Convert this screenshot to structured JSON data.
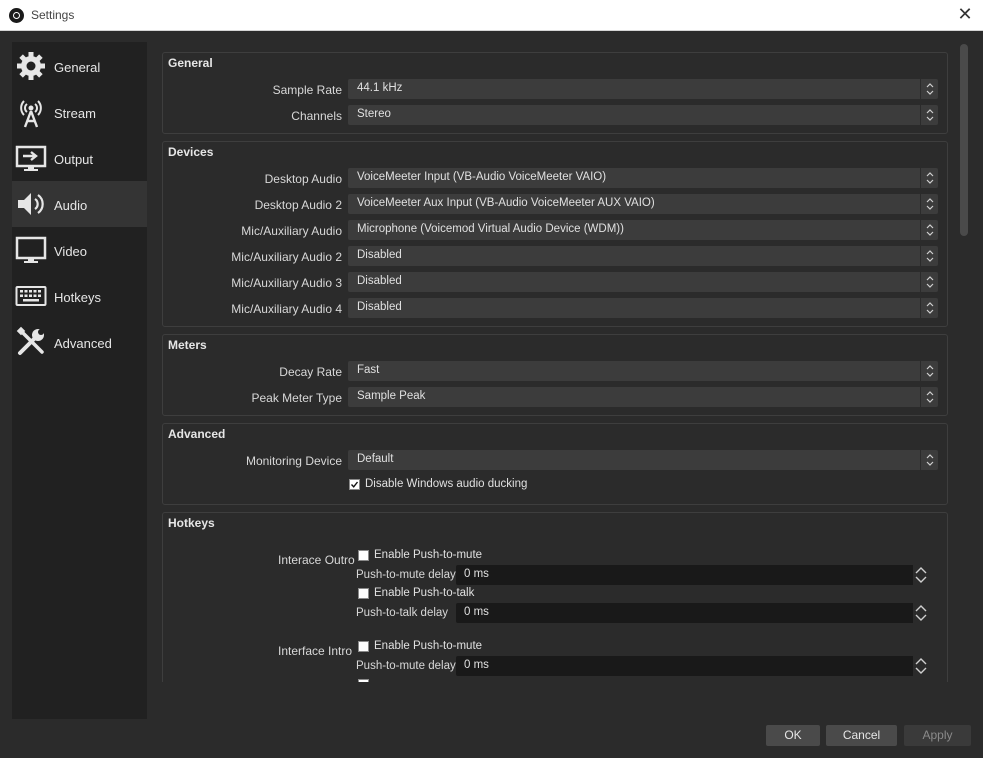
{
  "window": {
    "title": "Settings",
    "close_icon": "close-icon"
  },
  "sidebar": {
    "items": [
      {
        "label": "General",
        "icon": "gear-icon",
        "active": false
      },
      {
        "label": "Stream",
        "icon": "broadcast-tower-icon",
        "active": false
      },
      {
        "label": "Output",
        "icon": "output-monitor-icon",
        "active": false
      },
      {
        "label": "Audio",
        "icon": "speaker-icon",
        "active": true
      },
      {
        "label": "Video",
        "icon": "monitor-icon",
        "active": false
      },
      {
        "label": "Hotkeys",
        "icon": "keyboard-icon",
        "active": false
      },
      {
        "label": "Advanced",
        "icon": "tools-icon",
        "active": false
      }
    ]
  },
  "general": {
    "title": "General",
    "sample_rate": {
      "label": "Sample Rate",
      "value": "44.1 kHz"
    },
    "channels": {
      "label": "Channels",
      "value": "Stereo"
    }
  },
  "devices": {
    "title": "Devices",
    "rows": [
      {
        "label": "Desktop Audio",
        "value": "VoiceMeeter Input (VB-Audio VoiceMeeter VAIO)"
      },
      {
        "label": "Desktop Audio 2",
        "value": "VoiceMeeter Aux Input (VB-Audio VoiceMeeter AUX VAIO)"
      },
      {
        "label": "Mic/Auxiliary Audio",
        "value": "Microphone (Voicemod Virtual Audio Device (WDM))"
      },
      {
        "label": "Mic/Auxiliary Audio 2",
        "value": "Disabled"
      },
      {
        "label": "Mic/Auxiliary Audio 3",
        "value": "Disabled"
      },
      {
        "label": "Mic/Auxiliary Audio 4",
        "value": "Disabled"
      }
    ]
  },
  "meters": {
    "title": "Meters",
    "decay_rate": {
      "label": "Decay Rate",
      "value": "Fast"
    },
    "peak_meter_type": {
      "label": "Peak Meter Type",
      "value": "Sample Peak"
    }
  },
  "advanced": {
    "title": "Advanced",
    "monitoring_device": {
      "label": "Monitoring Device",
      "value": "Default"
    },
    "ducking": {
      "label": "Disable Windows audio ducking",
      "checked": true
    }
  },
  "hotkeys": {
    "title": "Hotkeys",
    "sources": [
      {
        "name": "Interace Outro",
        "push_to_mute_label": "Enable Push-to-mute",
        "push_to_mute_delay_label": "Push-to-mute delay",
        "push_to_mute_delay": "0 ms",
        "push_to_talk_label": "Enable Push-to-talk",
        "push_to_talk_delay_label": "Push-to-talk delay",
        "push_to_talk_delay": "0 ms"
      },
      {
        "name": "Interface Intro",
        "push_to_mute_label": "Enable Push-to-mute",
        "push_to_mute_delay_label": "Push-to-mute delay",
        "push_to_mute_delay": "0 ms"
      }
    ]
  },
  "buttons": {
    "ok": "OK",
    "cancel": "Cancel",
    "apply": "Apply"
  }
}
